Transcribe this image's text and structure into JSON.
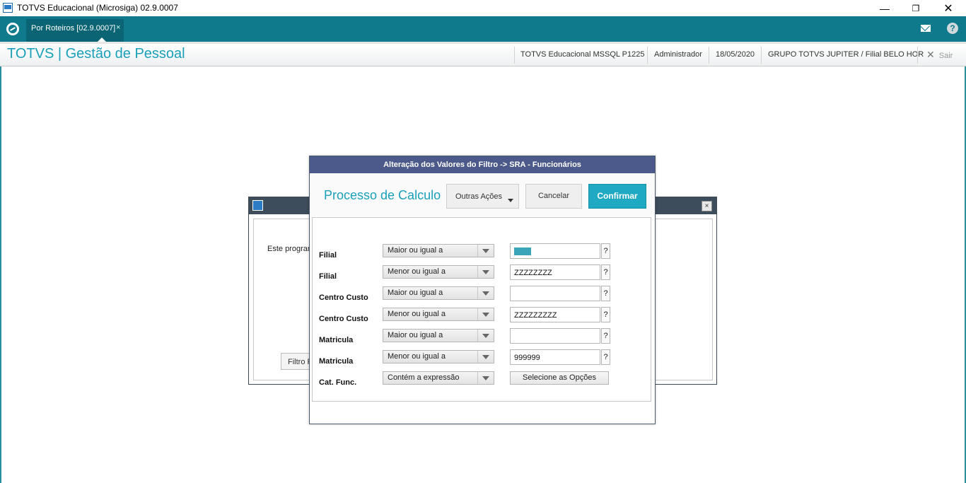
{
  "window": {
    "title": "TOTVS Educacional (Microsiga) 02.9.0007",
    "minimize": "—",
    "maximize": "❐",
    "close": "✕"
  },
  "tabs": [
    {
      "label": "Por Roteiros [02.9.0007]",
      "close": "×"
    }
  ],
  "header": {
    "app_title": "TOTVS | Gestão de Pessoal",
    "environment": "TOTVS Educacional MSSQL P1225",
    "user": "Administrador",
    "date": "18/05/2020",
    "company": "GRUPO TOTVS JUPITER / Filial BELO HOR",
    "exit_label": "Sair",
    "exit_icon": "✕",
    "help_icon": "?"
  },
  "background_dialog": {
    "text": "Este progran",
    "button_label": "Filtro R",
    "close": "×"
  },
  "modal": {
    "title": "Alteração dos Valores do Filtro -> SRA - Funcionários",
    "heading": "Processo de Calculo",
    "other_actions": "Outras Ações",
    "cancel": "Cancelar",
    "confirm": "Confirmar",
    "filters": [
      {
        "label": "Filial",
        "operator": "Maior ou igual a",
        "value": ""
      },
      {
        "label": "Filial",
        "operator": "Menor ou igual a",
        "value": "ZZZZZZZZ"
      },
      {
        "label": "Centro Custo",
        "operator": "Maior ou igual a",
        "value": ""
      },
      {
        "label": "Centro Custo",
        "operator": "Menor ou igual a",
        "value": "ZZZZZZZZZ"
      },
      {
        "label": "Matricula",
        "operator": "Maior ou igual a",
        "value": ""
      },
      {
        "label": "Matricula",
        "operator": "Menor ou igual a",
        "value": "999999"
      },
      {
        "label": "Cat. Func.",
        "operator": "Contém a expressão",
        "button": "Selecione as Opções"
      }
    ],
    "lookup_label": "?"
  }
}
